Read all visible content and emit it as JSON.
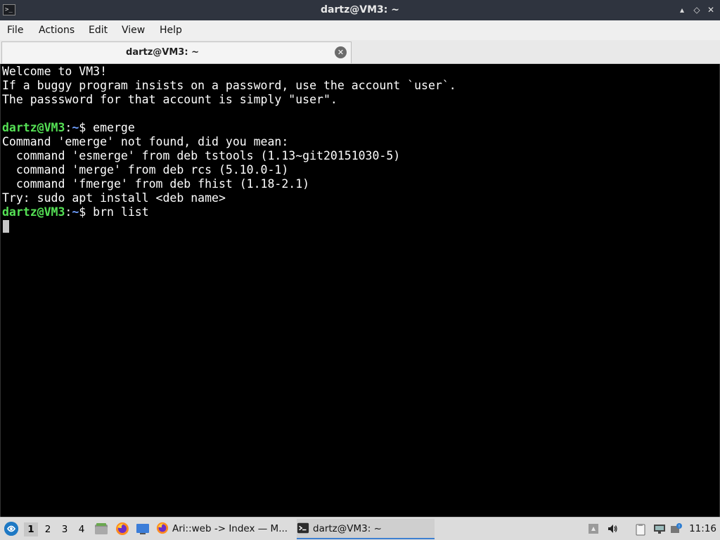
{
  "window": {
    "title": "dartz@VM3: ~",
    "minimize": "▴",
    "maximize": "◇",
    "close": "✕",
    "terminal_glyph": ">_"
  },
  "menu": {
    "file": "File",
    "actions": "Actions",
    "edit": "Edit",
    "view": "View",
    "help": "Help"
  },
  "tabs": [
    {
      "label": "dartz@VM3: ~",
      "close": "✕"
    }
  ],
  "terminal": {
    "welcome": [
      "Welcome to VM3!",
      "If a buggy program insists on a password, use the account `user`.",
      "The passsword for that account is simply \"user\"."
    ],
    "prompt_user": "dartz@VM3",
    "prompt_sep": ":",
    "prompt_path": "~",
    "prompt_end": "$ ",
    "cmd1": "emerge",
    "output": [
      "Command 'emerge' not found, did you mean:",
      "  command 'esmerge' from deb tstools (1.13~git20151030-5)",
      "  command 'merge' from deb rcs (5.10.0-1)",
      "  command 'fmerge' from deb fhist (1.18-2.1)",
      "Try: sudo apt install <deb name>"
    ],
    "cmd2": "brn list"
  },
  "taskbar": {
    "desktops": [
      "1",
      "2",
      "3",
      "4"
    ],
    "tasks": [
      {
        "label": "Ari::web -> Index — M...",
        "icon": "firefox-icon"
      },
      {
        "label": "dartz@VM3: ~",
        "icon": "terminal-icon"
      }
    ],
    "clock": "11:16"
  },
  "colors": {
    "prompt_user": "#55e155",
    "prompt_path": "#6f9fff",
    "titlebar": "#2f343f",
    "taskbar": "#dcdcdc"
  }
}
